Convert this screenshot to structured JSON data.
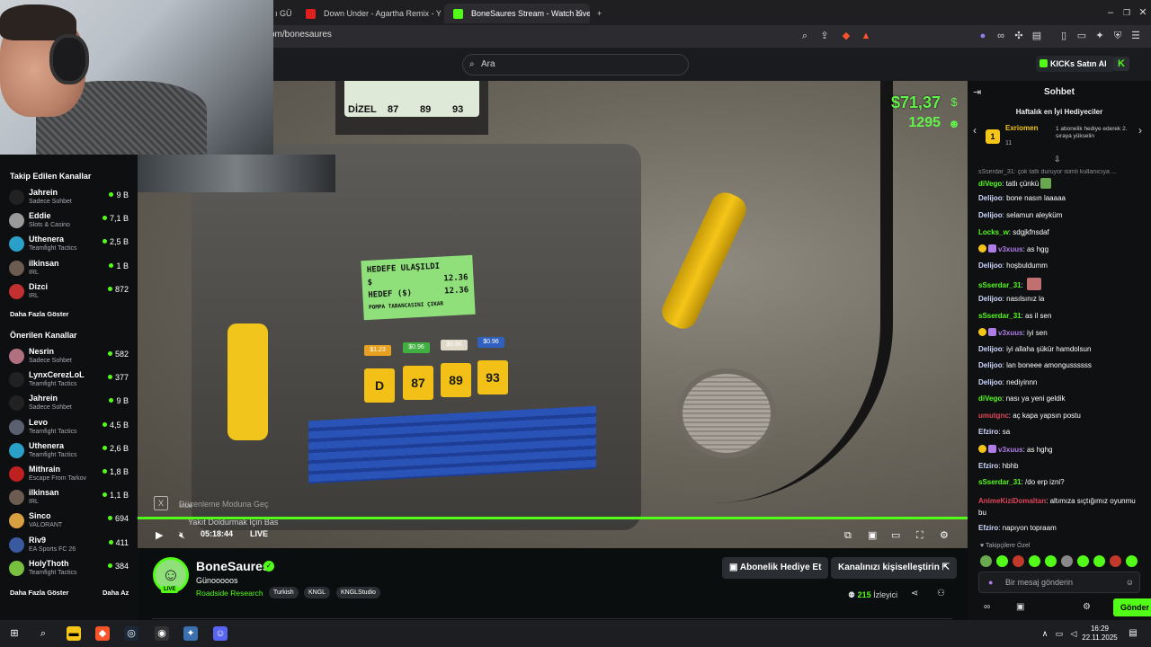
{
  "browser": {
    "tabs": [
      {
        "label": "ı GÜ",
        "active": false
      },
      {
        "label": "Down Under - Agartha Remix - YouT",
        "active": false
      },
      {
        "label": "BoneSaures Stream - Watch Live",
        "active": true
      }
    ],
    "url": "om/bonesaures"
  },
  "header": {
    "search_placeholder": "Ara",
    "buy_ai_label": "KICKs Satın Al"
  },
  "sidebar": {
    "followed_title": "Takip Edilen Kanallar",
    "followed": [
      {
        "name": "Jahrein",
        "category": "Sadece Sohbet",
        "viewers": "9 B",
        "color": "#222"
      },
      {
        "name": "Eddie",
        "category": "Slots & Casino",
        "viewers": "7,1 B",
        "color": "#9a9a9a"
      },
      {
        "name": "Uthenera",
        "category": "Teamfight Tactics",
        "viewers": "2,5 B",
        "color": "#2aa0c8"
      },
      {
        "name": "ilkinsan",
        "category": "IRL",
        "viewers": "1 B",
        "color": "#6b5b50"
      },
      {
        "name": "Dizci",
        "category": "IRL",
        "viewers": "872",
        "color": "#c23030"
      }
    ],
    "show_more": "Daha Fazla Göster",
    "recommended_title": "Önerilen Kanallar",
    "recommended": [
      {
        "name": "Nesrin",
        "category": "Sadece Sohbet",
        "viewers": "582",
        "color": "#b07080"
      },
      {
        "name": "LynxCerezLoL",
        "category": "Teamfight Tactics",
        "viewers": "377",
        "color": "#222"
      },
      {
        "name": "Jahrein",
        "category": "Sadece Sohbet",
        "viewers": "9 B",
        "color": "#222"
      },
      {
        "name": "Levo",
        "category": "Teamfight Tactics",
        "viewers": "4,5 B",
        "color": "#5a6070"
      },
      {
        "name": "Uthenera",
        "category": "Teamfight Tactics",
        "viewers": "2,6 B",
        "color": "#2aa0c8"
      },
      {
        "name": "Mithrain",
        "category": "Escape From Tarkov",
        "viewers": "1,8 B",
        "color": "#c02020"
      },
      {
        "name": "ilkinsan",
        "category": "IRL",
        "viewers": "1,1 B",
        "color": "#6b5b50"
      },
      {
        "name": "Sinco",
        "category": "VALORANT",
        "viewers": "694",
        "color": "#d8a040"
      },
      {
        "name": "Riv9",
        "category": "EA Sports FC 26",
        "viewers": "411",
        "color": "#3a5aa0"
      },
      {
        "name": "HolyThoth",
        "category": "Teamfight Tactics",
        "viewers": "384",
        "color": "#78c040"
      }
    ],
    "show_more_2": "Daha Fazla Göster",
    "show_less": "Daha Az"
  },
  "game": {
    "money": "$71,37",
    "xp": "1295",
    "pump_labels": [
      "DİZEL",
      "87",
      "89",
      "93"
    ],
    "screen_line1": "HEDEFE ULAŞILDI",
    "screen_line2_label": "$",
    "screen_line2_value": "12.36",
    "screen_line3_label": "HEDEF ($)",
    "screen_line3_value": "12.36",
    "screen_line4": "POMPA TABANCASINI ÇIKAR",
    "fuel_buttons": [
      {
        "label": "D",
        "price": "$1.23",
        "color": "#e8a020"
      },
      {
        "label": "87",
        "price": "$0.96",
        "color": "#40b040"
      },
      {
        "label": "89",
        "price": "$0.86",
        "color": "#e0d8c8"
      },
      {
        "label": "93",
        "price": "$0.96",
        "color": "#3060c0"
      }
    ],
    "hint_small": "İnce",
    "hint_mode": "Düzenleme Moduna Geç",
    "hint_refuel": "Yakıt Doldurmak İçin Bas"
  },
  "player": {
    "time": "05:18:44",
    "live_label": "LIVE"
  },
  "stream": {
    "channel": "BoneSaures",
    "title": "Günooooos",
    "category": "Roadside Research",
    "tags": [
      "Turkish",
      "KNGL",
      "KNGLStudio"
    ],
    "gift_sub_label": "Abonelik Hediye Et",
    "customize_label": "Kanalınızı kişiselleştirin",
    "viewer_count": "215",
    "viewer_suffix": "İzleyici"
  },
  "chat": {
    "title": "Sohbet",
    "gifters_title": "Haftalık en İyi Hediyeciler",
    "gifter_name": "Exriomen",
    "gifter_rank": "1",
    "gifter_count": "11",
    "gift_hint": "1 abonelik hediye ederek 2. sıraya yükselin",
    "reply_preview": "sSserdar_31: çok tatlı duruyor isimli kullanıcıya ...",
    "messages": [
      {
        "user": "diVego",
        "text": "tatlı çünkü",
        "color": "#53fc18",
        "badges": 0
      },
      {
        "user": "Delijoo",
        "text": "bone nasın laaaaa",
        "color": "#cfd8ff",
        "badges": 0
      },
      {
        "user": "Delijoo",
        "text": "selamun aleyküm",
        "color": "#cfd8ff",
        "badges": 0
      },
      {
        "user": "Locks_w",
        "text": "sdgjkfnsdaf",
        "color": "#53fc18",
        "badges": 0
      },
      {
        "user": "v3xuus",
        "text": "as hgg",
        "color": "#b07ce8",
        "badges": 2
      },
      {
        "user": "Delijoo",
        "text": "hoşbuldumm",
        "color": "#cfd8ff",
        "badges": 0
      },
      {
        "user": "sSserdar_31",
        "text": "",
        "color": "#53fc18",
        "badges": 0
      },
      {
        "user": "Delijoo",
        "text": "nasılsınız la",
        "color": "#cfd8ff",
        "badges": 0
      },
      {
        "user": "sSserdar_31",
        "text": "as il sen",
        "color": "#53fc18",
        "badges": 0
      },
      {
        "user": "v3xuus",
        "text": "iyi sen",
        "color": "#b07ce8",
        "badges": 2
      },
      {
        "user": "Delijoo",
        "text": "iyi allaha şükür hamdolsun",
        "color": "#cfd8ff",
        "badges": 0
      },
      {
        "user": "Delijoo",
        "text": "lan boneee amongussssss",
        "color": "#cfd8ff",
        "badges": 0
      },
      {
        "user": "Delijoo",
        "text": "nediyinnn",
        "color": "#cfd8ff",
        "badges": 0
      },
      {
        "user": "diVego",
        "text": "nası ya yeni geldik",
        "color": "#53fc18",
        "badges": 0
      },
      {
        "user": "umutgnc",
        "text": "aç kapa yapsın postu",
        "color": "#e0455a",
        "badges": 0
      },
      {
        "user": "Efziro",
        "text": "sa",
        "color": "#cfd8ff",
        "badges": 0
      },
      {
        "user": "v3xuus",
        "text": "as hghg",
        "color": "#b07ce8",
        "badges": 2
      },
      {
        "user": "Efziro",
        "text": "hbhb",
        "color": "#cfd8ff",
        "badges": 0
      },
      {
        "user": "sSserdar_31",
        "text": "/do erp izni?",
        "color": "#53fc18",
        "badges": 0
      },
      {
        "user": "AnimeKiziDomaltan",
        "text": "altımıza sıçtığımız oyunmu bu",
        "color": "#e0455a",
        "badges": 0
      },
      {
        "user": "Efziro",
        "text": "napıyon topraam",
        "color": "#cfd8ff",
        "badges": 0
      }
    ],
    "subs_only": "Takipçilere Özel",
    "input_placeholder": "Bir mesaj gönderin",
    "send_label": "Gönder"
  },
  "taskbar": {
    "time": "16:29",
    "date": "22.11.2025"
  }
}
